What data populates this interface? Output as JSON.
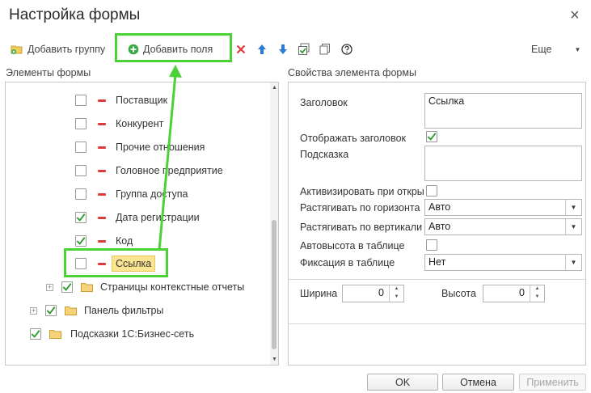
{
  "window": {
    "title": "Настройка формы",
    "close_glyph": "×"
  },
  "toolbar": {
    "add_group": "Добавить группу",
    "add_fields": "Добавить поля",
    "more": "Еще"
  },
  "left_panel": {
    "header": "Элементы формы"
  },
  "tree": [
    {
      "label": "Поставщик",
      "checked": false
    },
    {
      "label": "Конкурент",
      "checked": false
    },
    {
      "label": "Прочие отношения",
      "checked": false
    },
    {
      "label": "Головное предприятие",
      "checked": false
    },
    {
      "label": "Группа доступа",
      "checked": false
    },
    {
      "label": "Дата регистрации",
      "checked": true
    },
    {
      "label": "Код",
      "checked": true
    },
    {
      "label": "Ссылка",
      "checked": false,
      "selected": true
    },
    {
      "label": "Страницы контекстные отчеты",
      "checked": true
    },
    {
      "label": "Панель фильтры",
      "checked": true
    },
    {
      "label": "Подсказки 1С:Бизнес-сеть",
      "checked": true
    }
  ],
  "right_panel": {
    "header": "Свойства элемента формы",
    "title_label": "Заголовок",
    "title_value": "Ссылка",
    "show_title_label": "Отображать заголовок",
    "show_title_checked": true,
    "hint_label": "Подсказка",
    "hint_value": "",
    "activate_label": "Активизировать при откры",
    "stretch_h_label": "Растягивать по горизонта",
    "stretch_h_value": "Авто",
    "stretch_v_label": "Растягивать по вертикали",
    "stretch_v_value": "Авто",
    "autoheight_label": "Автовысота в таблице",
    "fixing_label": "Фиксация в таблице",
    "fixing_value": "Нет",
    "width_label": "Ширина",
    "width_value": "0",
    "height_label": "Высота",
    "height_value": "0"
  },
  "footer": {
    "ok": "OK",
    "cancel": "Отмена",
    "apply": "Применить"
  },
  "colors": {
    "highlight_green": "#4cd137",
    "selection_yellow": "#fbe591",
    "check_green": "#2e9b2e",
    "delete_red": "#e03a3a",
    "arrow_blue": "#2a7ad6"
  }
}
